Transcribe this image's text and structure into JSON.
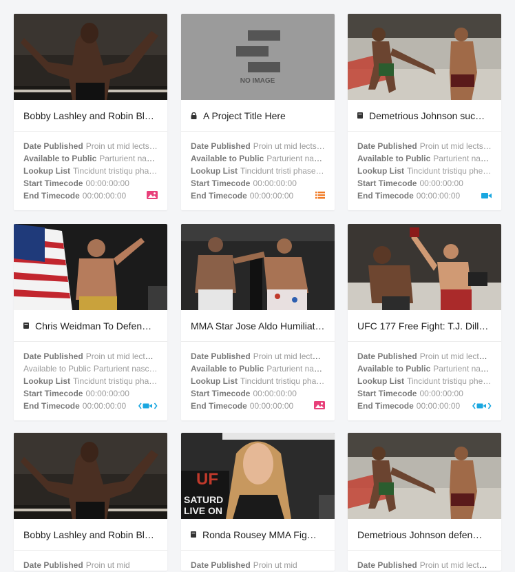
{
  "colors": {
    "accent_pink": "#e8407a",
    "accent_orange": "#f07a25",
    "accent_blue": "#1aa7e0"
  },
  "labels": {
    "date_published": "Date Published",
    "available_to_public": "Available to Public",
    "lookup_list": "Lookup List",
    "start_timecode": "Start Timecode",
    "end_timecode": "End Timecode"
  },
  "no_image_text": "NO IMAGE",
  "cards": [
    {
      "title": "Bobby Lashley and Robin Bl…",
      "title_icon": "",
      "image": "bobby-lashley-arms-spread",
      "date_published": "Proin ut mid lects…",
      "available_to_public": "Parturient nast…",
      "lookup_list": "Tincidunt tristiqu pha…",
      "start_timecode": "00:00:00:00",
      "end_timecode": "00:00:00:00",
      "type_icon": "image-icon",
      "available_dim": false
    },
    {
      "title": "A Project Title Here",
      "title_icon": "lock-icon",
      "image": "no-image",
      "date_published": "Proin ut mid lects…",
      "available_to_public": "Parturient naet…",
      "lookup_list": "Tincidunt tristi phase…",
      "start_timecode": "00:00:00:00",
      "end_timecode": "00:00:00:00",
      "type_icon": "list-icon",
      "available_dim": false
    },
    {
      "title": "Demetrious Johnson suc…",
      "title_icon": "document-icon",
      "image": "demetrious-johnson-kick",
      "date_published": "Proin ut mid lects…",
      "available_to_public": "Parturient nast…",
      "lookup_list": "Tincidunt tristiqu phe…",
      "start_timecode": "00:00:00:00",
      "end_timecode": "00:00:00:00",
      "type_icon": "video-icon",
      "available_dim": false
    },
    {
      "title": "Chris Weidman To Defen…",
      "title_icon": "document-icon",
      "image": "chris-weidman-flag",
      "date_published": "Proin ut mid lectus…",
      "available_to_public": "Parturient nasc…",
      "lookup_list": "Tincidunt tristiqu pha…",
      "start_timecode": "00:00:00:00",
      "end_timecode": "00:00:00:00",
      "type_icon": "embed-video-icon",
      "available_dim": true
    },
    {
      "title": "MMA Star Jose Aldo Humiliat…",
      "title_icon": "",
      "image": "jose-aldo-fight",
      "date_published": "Proin ut mid lectus…",
      "available_to_public": "Parturient nasc…",
      "lookup_list": "Tincidunt tristiqu pha…",
      "start_timecode": "00:00:00:00",
      "end_timecode": "00:00:00:00",
      "type_icon": "image-icon",
      "available_dim": false
    },
    {
      "title": "UFC 177 Free Fight: T.J. Dillas…",
      "title_icon": "",
      "image": "tj-dillashaw-fight",
      "date_published": "Proin ut mid lectus…",
      "available_to_public": "Parturient nast…",
      "lookup_list": "Tincidunt tristiqu phe…",
      "start_timecode": "00:00:00:00",
      "end_timecode": "00:00:00:00",
      "type_icon": "embed-video-icon",
      "available_dim": false
    },
    {
      "title": "Bobby Lashley and Robin Bl…",
      "title_icon": "",
      "image": "bobby-lashley-arms-spread",
      "date_published": "Proin ut mid",
      "available_to_public": "",
      "lookup_list": "",
      "start_timecode": "",
      "end_timecode": "",
      "type_icon": "",
      "available_dim": false
    },
    {
      "title": "Ronda Rousey MMA Fig…",
      "title_icon": "document-icon",
      "image": "ronda-rousey-portrait",
      "date_published": "Proin ut mid",
      "available_to_public": "",
      "lookup_list": "",
      "start_timecode": "",
      "end_timecode": "",
      "type_icon": "",
      "available_dim": false
    },
    {
      "title": "Demetrious Johnson defen…",
      "title_icon": "",
      "image": "demetrious-johnson-kick",
      "date_published": "Proin ut mid lectus…",
      "available_to_public": "",
      "lookup_list": "",
      "start_timecode": "",
      "end_timecode": "",
      "type_icon": "",
      "available_dim": false
    }
  ]
}
